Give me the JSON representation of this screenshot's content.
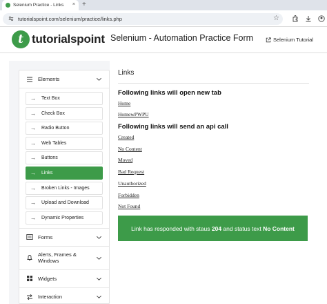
{
  "browser": {
    "tab_title": "Selenium Practice - Links",
    "tab_close": "×",
    "new_tab": "+",
    "url": "tutorialspoint.com/selenium/practice/links.php",
    "star": "☆"
  },
  "header": {
    "logo_letter": "t",
    "logo_text": "tutorialspoint",
    "title": "Selenium - Automation Practice Form",
    "tutorial_link": "Selenium Tutorial"
  },
  "sidebar": {
    "elements_label": "Elements",
    "items": [
      {
        "label": "Text Box",
        "active": false
      },
      {
        "label": "Check Box",
        "active": false
      },
      {
        "label": "Radio Button",
        "active": false
      },
      {
        "label": "Web Tables",
        "active": false
      },
      {
        "label": "Buttons",
        "active": false
      },
      {
        "label": "Links",
        "active": true
      },
      {
        "label": "Broken Links - Images",
        "active": false
      },
      {
        "label": "Upload and Download",
        "active": false
      },
      {
        "label": "Dynamic Properties",
        "active": false
      }
    ],
    "arrow": "→",
    "forms_label": "Forms",
    "alerts_label_1": "Alerts, Frames &",
    "alerts_label_2": "Windows",
    "widgets_label": "Widgets",
    "interaction_label": "Interaction"
  },
  "main": {
    "heading": "Links",
    "section_new_tab": "Following links will open new tab",
    "link_home": "Home",
    "link_home_pwpu": "HomewPWPU",
    "section_api": "Following links will send an api call",
    "link_created": "Created",
    "link_no_content": "No Content",
    "link_moved": "Moved",
    "link_bad_request": "Bad Request",
    "link_unauthorized": "Unauthorized",
    "link_forbidden": "Forbidden",
    "link_not_found": "Not Found",
    "alert_prefix": "Link has responded with staus ",
    "alert_code": "204",
    "alert_mid": " and status text ",
    "alert_text": "No Content"
  },
  "colors": {
    "brand_green": "#3d9b49"
  }
}
